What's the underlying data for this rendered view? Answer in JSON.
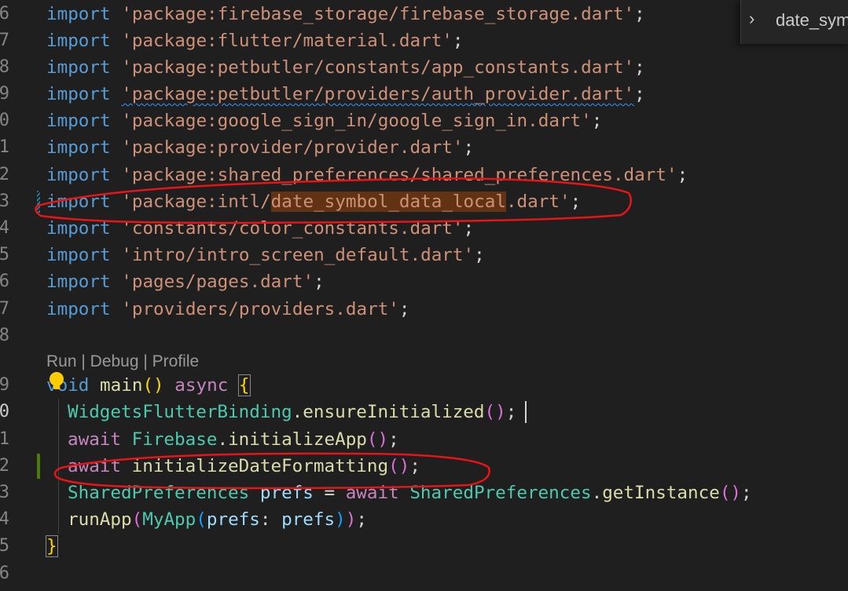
{
  "breadcrumb": {
    "chevron": "›",
    "label": "date_sym"
  },
  "codelens": {
    "run": "Run",
    "debug": "Debug",
    "profile": "Profile",
    "separator": " | "
  },
  "gutter": [
    "6",
    "7",
    "8",
    "9",
    "0",
    "1",
    "2",
    "3",
    "4",
    "5",
    "6",
    "7",
    "8",
    "9",
    "0",
    "1",
    "2",
    "3",
    "4",
    "5",
    "6"
  ],
  "code": {
    "import": "import",
    "semicolon": ";",
    "imports": [
      "'package:firebase_storage/firebase_storage.dart'",
      "'package:flutter/material.dart'",
      "'package:petbutler/constants/app_constants.dart'",
      "'package:petbutler/providers/auth_provider.dart'",
      "'package:google_sign_in/google_sign_in.dart'",
      "'package:provider/provider.dart'",
      "'package:shared_preferences/shared_preferences.dart'",
      "'constants/color_constants.dart'",
      "'intro/intro_screen_default.dart'",
      "'pages/pages.dart'",
      "'providers/providers.dart'"
    ],
    "intl_import": {
      "pre": "'package:intl/",
      "highlight": "date_symbol_data_local",
      "post": ".dart'"
    },
    "main_sig": {
      "void": "void",
      "name": "main",
      "parens": "()",
      "async": "async",
      "brace_open": "{"
    },
    "body": {
      "l1_type": "WidgetsFlutterBinding",
      "l1_dot": ".",
      "l1_fn": "ensureInitialized",
      "await": "await",
      "l2_type": "Firebase",
      "l2_dot": ".",
      "l2_fn": "initializeApp",
      "l3_fn": "initializeDateFormatting",
      "l4_type": "SharedPreferences",
      "l4_var": "prefs",
      "l4_eq": "=",
      "l4_type2": "SharedPreferences",
      "l4_dot": ".",
      "l4_fn": "getInstance",
      "l5_fn": "runApp",
      "l5_ctor": "MyApp",
      "l5_param": "prefs",
      "l5_colon": ":",
      "l5_arg": "prefs",
      "paren_open": "(",
      "paren_close": ")",
      "empty_parens": "()"
    },
    "brace_close": "}"
  },
  "colors": {
    "background": "#1f1f1f",
    "keyword": "#569cd6",
    "control": "#c586c0",
    "string": "#ce9178",
    "function": "#dcdcaa",
    "type": "#4ec9b0",
    "variable": "#9cdcfe",
    "annotation_ink": "#e81416",
    "find_highlight": "#613214"
  }
}
